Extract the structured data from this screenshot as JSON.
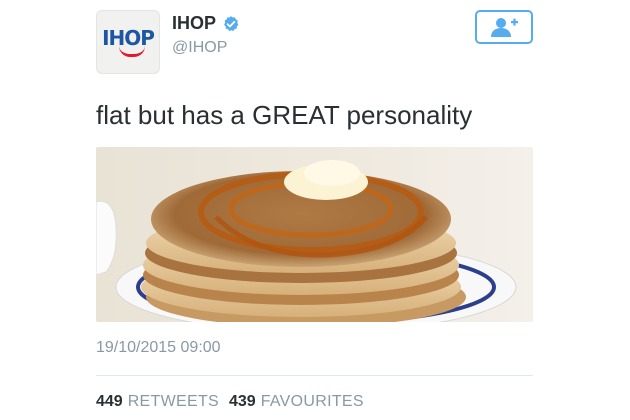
{
  "account": {
    "avatar_text": "IHOP",
    "display_name": "IHOP",
    "handle": "@IHOP",
    "verified_icon": "verified-badge-icon"
  },
  "follow_button": {
    "icon": "add-user-icon"
  },
  "tweet": {
    "text": "flat but has a GREAT personality",
    "photo_subject": "stack of pancakes with butter and syrup",
    "timestamp": "19/10/2015 09:00"
  },
  "stats": {
    "retweets_count": "449",
    "retweets_label": "RETWEETS",
    "favourites_count": "439",
    "favourites_label": "FAVOURITES"
  },
  "colors": {
    "accent": "#55acee",
    "brand_blue": "#1d56a5",
    "brand_red": "#e3192c"
  }
}
